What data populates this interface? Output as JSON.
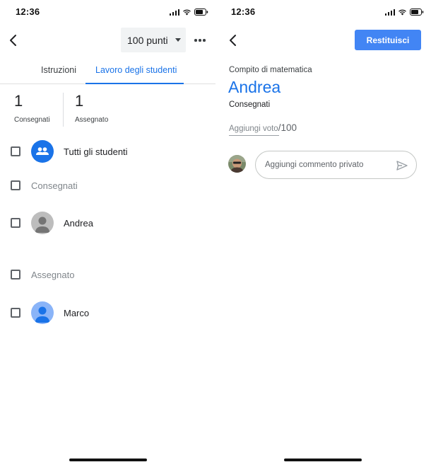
{
  "left": {
    "status_time": "12:36",
    "points_select": "100 punti",
    "tabs": [
      {
        "label": "Istruzioni"
      },
      {
        "label": "Lavoro degli studenti"
      }
    ],
    "stats": [
      {
        "value": "1",
        "label": "Consegnati"
      },
      {
        "value": "1",
        "label": "Assegnato"
      }
    ],
    "all_students_label": "Tutti gli studenti",
    "sections": [
      {
        "label": "Consegnati",
        "students": [
          {
            "name": "Andrea"
          }
        ]
      },
      {
        "label": "Assegnato",
        "students": [
          {
            "name": "Marco"
          }
        ]
      }
    ]
  },
  "right": {
    "status_time": "12:36",
    "return_button": "Restituisci",
    "assignment_title": "Compito di matematica",
    "student_name": "Andrea",
    "status": "Consegnati",
    "grade_placeholder": "Aggiungi voto",
    "grade_max": "/100",
    "comment_placeholder": "Aggiungi commento privato"
  },
  "colors": {
    "accent": "#1a73e8",
    "button": "#4285f4",
    "avatar_blue": "#1a73e8",
    "avatar_light_blue": "#8ab4f8",
    "avatar_gray": "#bdbdbd"
  },
  "icons": {
    "back": "chevron-left-icon",
    "more": "more-horizontal-icon",
    "dropdown": "caret-down-icon",
    "all_students": "people-group-icon",
    "student": "person-icon",
    "send": "send-icon"
  }
}
